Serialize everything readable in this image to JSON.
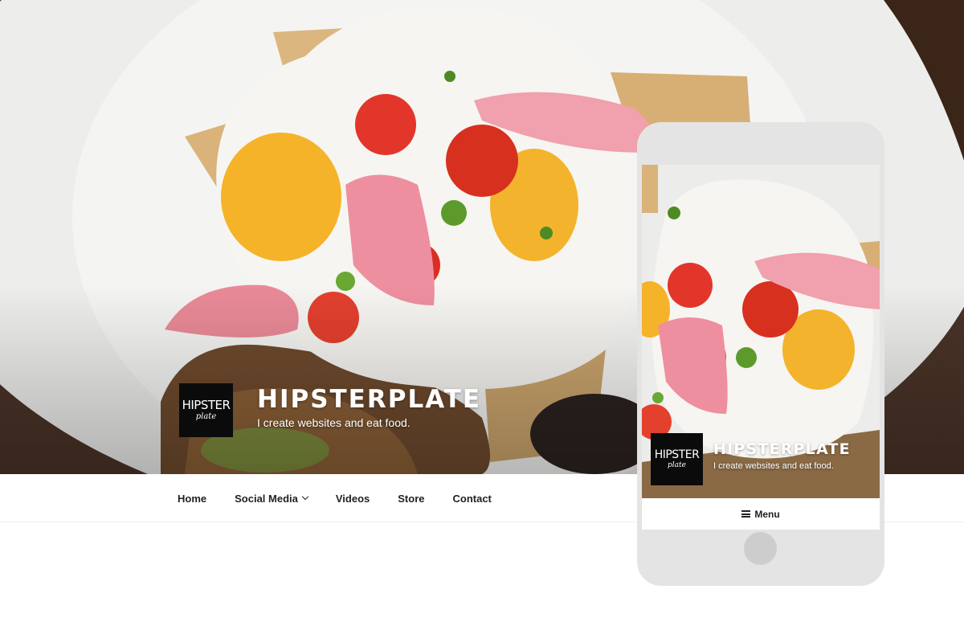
{
  "site": {
    "title": "HIPSTERPLATE",
    "tagline": "I create websites and eat food.",
    "logo_line1": "HIPSTER",
    "logo_line2": "plate"
  },
  "nav": {
    "items": [
      {
        "label": "Home"
      },
      {
        "label": "Social Media",
        "has_submenu": true
      },
      {
        "label": "Videos"
      },
      {
        "label": "Store"
      },
      {
        "label": "Contact"
      }
    ]
  },
  "mobile": {
    "menu_label": "Menu",
    "menu_icon": "hamburger-icon"
  },
  "colors": {
    "logo_bg": "#0b0b0b",
    "phone_frame": "#e4e4e4",
    "home_button": "#cdcdcd",
    "nav_text": "#222222"
  }
}
